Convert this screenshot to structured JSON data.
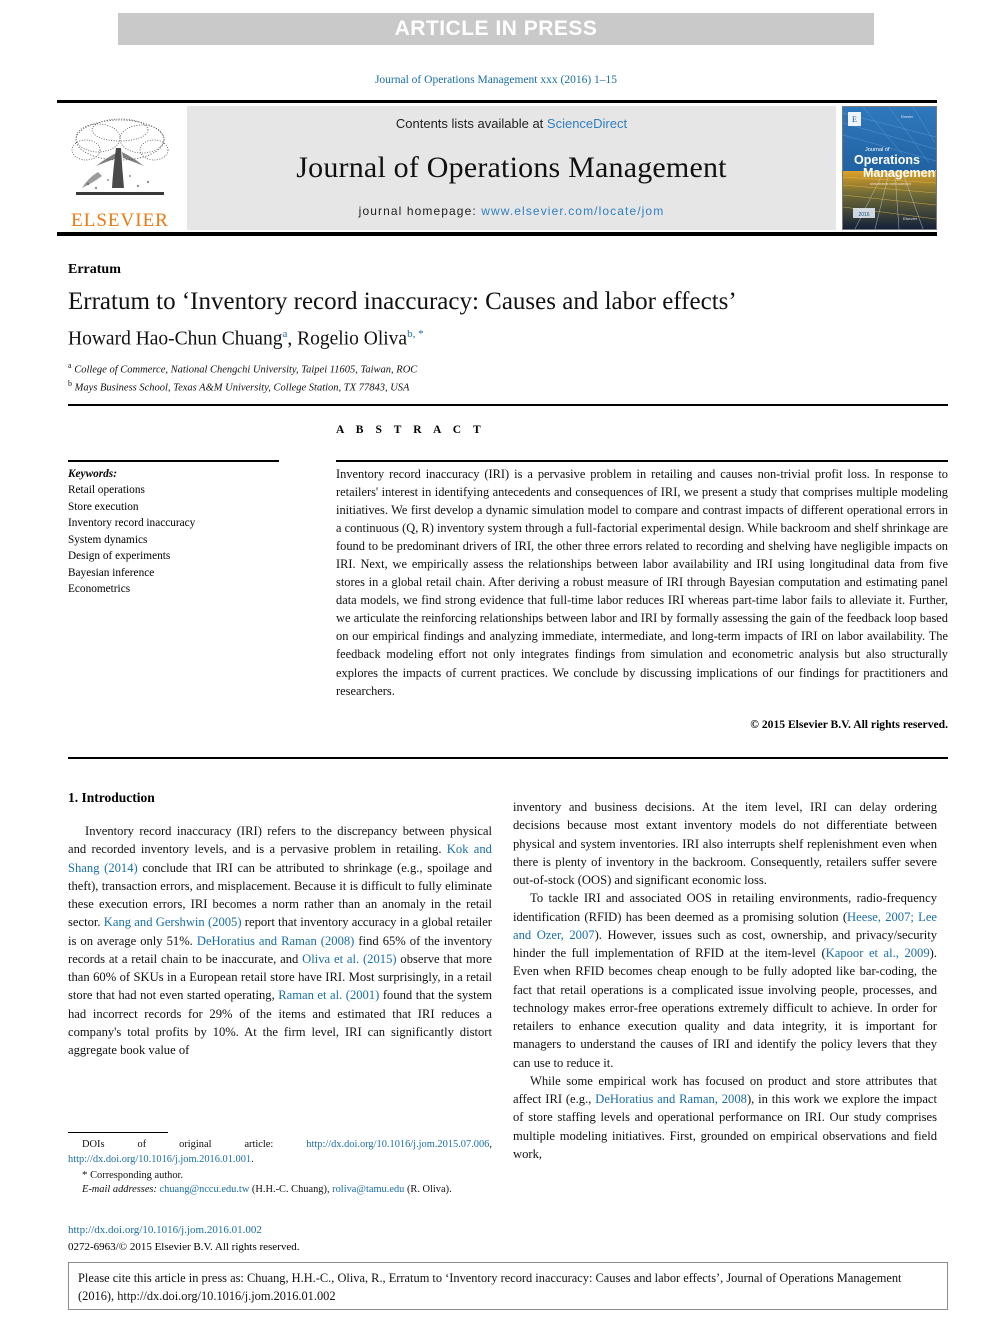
{
  "banner": {
    "label": "ARTICLE IN PRESS"
  },
  "running_head": "Journal of Operations Management xxx (2016) 1–15",
  "masthead": {
    "contents_prefix": "Contents lists available at ",
    "sciencedirect": "ScienceDirect",
    "journal_name": "Journal of Operations Management",
    "homepage_prefix": "journal homepage: ",
    "homepage_url": "www.elsevier.com/locate/jom",
    "publisher": "ELSEVIER",
    "publisher_color": "#e87a12",
    "link_color": "#2f7fc1",
    "cover": {
      "line1": "Journal of",
      "line2": "Operations",
      "line3": "Management",
      "corner_note": "Elsevier"
    }
  },
  "article": {
    "type_label": "Erratum",
    "title": "Erratum to ‘Inventory record inaccuracy: Causes and labor effects’",
    "authors": [
      {
        "name": "Howard Hao-Chun Chuang",
        "marks": "a"
      },
      {
        "name": "Rogelio Oliva",
        "marks": "b, *"
      }
    ],
    "affiliations": [
      {
        "mark": "a",
        "text": "College of Commerce, National Chengchi University, Taipei 11605, Taiwan, ROC"
      },
      {
        "mark": "b",
        "text": "Mays Business School, Texas A&M University, College Station, TX 77843, USA"
      }
    ]
  },
  "keywords": {
    "title": "Keywords:",
    "items": [
      "Retail operations",
      "Store execution",
      "Inventory record inaccuracy",
      "System dynamics",
      "Design of experiments",
      "Bayesian inference",
      "Econometrics"
    ]
  },
  "abstract": {
    "heading": "A B S T R A C T",
    "text": "Inventory record inaccuracy (IRI) is a pervasive problem in retailing and causes non-trivial profit loss. In response to retailers' interest in identifying antecedents and consequences of IRI, we present a study that comprises multiple modeling initiatives. We first develop a dynamic simulation model to compare and contrast impacts of different operational errors in a continuous (Q, R) inventory system through a full-factorial experimental design. While backroom and shelf shrinkage are found to be predominant drivers of IRI, the other three errors related to recording and shelving have negligible impacts on IRI. Next, we empirically assess the relationships between labor availability and IRI using longitudinal data from five stores in a global retail chain. After deriving a robust measure of IRI through Bayesian computation and estimating panel data models, we find strong evidence that full-time labor reduces IRI whereas part-time labor fails to alleviate it. Further, we articulate the reinforcing relationships between labor and IRI by formally assessing the gain of the feedback loop based on our empirical findings and analyzing immediate, intermediate, and long-term impacts of IRI on labor availability. The feedback modeling effort not only integrates findings from simulation and econometric analysis but also structurally explores the impacts of current practices. We conclude by discussing implications of our findings for practitioners and researchers.",
    "copyright": "© 2015 Elsevier B.V. All rights reserved."
  },
  "body": {
    "section_heading": "1. Introduction",
    "left_column": {
      "para1_part1": "Inventory record inaccuracy (IRI) refers to the discrepancy between physical and recorded inventory levels, and is a pervasive problem in retailing. ",
      "ref1": "Kok and Shang (2014)",
      "para1_part2": " conclude that IRI can be attributed to shrinkage (e.g., spoilage and theft), transaction errors, and misplacement. Because it is difficult to fully eliminate these execution errors, IRI becomes a norm rather than an anomaly in the retail sector. ",
      "ref2": "Kang and Gershwin (2005)",
      "para1_part3": " report that inventory accuracy in a global retailer is on average only 51%. ",
      "ref3": "DeHoratius and Raman (2008)",
      "para1_part4": " find 65% of the inventory records at a retail chain to be inaccurate, and ",
      "ref4": "Oliva et al. (2015)",
      "para1_part5": " observe that more than 60% of SKUs in a European retail store have IRI. Most surprisingly, in a retail store that had not even started operating, ",
      "ref5": "Raman et al. (2001)",
      "para1_part6": " found that the system had incorrect records for 29% of the items and estimated that IRI reduces a company's total profits by 10%. At the firm level, IRI can significantly distort aggregate book value of"
    },
    "right_column": {
      "para_cont": "inventory and business decisions. At the item level, IRI can delay ordering decisions because most extant inventory models do not differentiate between physical and system inventories. IRI also interrupts shelf replenishment even when there is plenty of inventory in the backroom. Consequently, retailers suffer severe out-of-stock (OOS) and significant economic loss.",
      "para2_part1": "To tackle IRI and associated OOS in retailing environments, radio-frequency identification (RFID) has been deemed as a promising solution (",
      "ref6": "Heese, 2007; Lee and Ozer, 2007",
      "para2_part2": "). However, issues such as cost, ownership, and privacy/security hinder the full implementation of RFID at the item-level (",
      "ref7": "Kapoor et al., 2009",
      "para2_part3": "). Even when RFID becomes cheap enough to be fully adopted like bar-coding, the fact that retail operations is a complicated issue involving people, processes, and technology makes error-free operations extremely difficult to achieve. In order for retailers to enhance execution quality and data integrity, it is important for managers to understand the causes of IRI and identify the policy levers that they can use to reduce it.",
      "para3_part1": "While some empirical work has focused on product and store attributes that affect IRI (e.g., ",
      "ref8": "DeHoratius and Raman, 2008",
      "para3_part2": "), in this work we explore the impact of store staffing levels and operational performance on IRI. Our study comprises multiple modeling initiatives. First, grounded on empirical observations and field work,"
    }
  },
  "footnotes": {
    "doi_label": "DOIs of original article: ",
    "doi_link1": "http://dx.doi.org/10.1016/j.jom.2015.07.006",
    "doi_sep": ", ",
    "doi_link2": "http://dx.doi.org/10.1016/j.jom.2016.01.001",
    "doi_end": ".",
    "corresponding": "Corresponding author.",
    "corresponding_star": "*",
    "email_label": "E-mail addresses:",
    "email1": "chuang@nccu.edu.tw",
    "email1_owner": " (H.H.-C. Chuang), ",
    "email2": "roliva@tamu.edu",
    "email2_owner": " (R. Oliva)."
  },
  "bottom": {
    "doi": "http://dx.doi.org/10.1016/j.jom.2016.01.002",
    "issn_line": "0272-6963/© 2015 Elsevier B.V. All rights reserved."
  },
  "citation_box": {
    "text": "Please cite this article in press as: Chuang, H.H.-C., Oliva, R., Erratum to ‘Inventory record inaccuracy: Causes and labor effects’, Journal of Operations Management (2016), http://dx.doi.org/10.1016/j.jom.2016.01.002"
  },
  "colors": {
    "link": "#1a6ea5",
    "banner_bg": "#c9c9c9",
    "masthead_bg": "#e6e6e6",
    "elsevier_orange": "#e87a12"
  }
}
